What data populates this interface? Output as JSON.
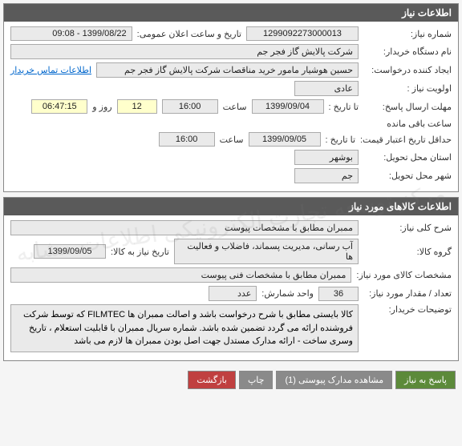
{
  "panel1": {
    "title": "اطلاعات نیاز",
    "need_number_label": "شماره نیاز:",
    "need_number": "1299092273000013",
    "public_datetime_label": "تاریخ و ساعت اعلان عمومی:",
    "public_datetime": "1399/08/22 - 09:08",
    "buyer_org_label": "نام دستگاه خریدار:",
    "buyer_org": "شرکت پالایش گاز فجر جم",
    "creator_label": "ایجاد کننده درخواست:",
    "creator": "حسین هوشیار مامور خرید مناقصات شرکت پالایش گاز فجر جم",
    "contact_link": "اطلاعات تماس خریدار",
    "priority_label": "اولویت نیاز :",
    "priority": "عادی",
    "deadline_label": "مهلت ارسال پاسخ:",
    "to_date_label": "تا تاریخ :",
    "deadline_date": "1399/09/04",
    "time_label": "ساعت",
    "deadline_time": "16:00",
    "days_remaining": "12",
    "days_label": "روز و",
    "time_remaining": "06:47:15",
    "remaining_label": "ساعت باقی مانده",
    "price_validity_label": "حداقل تاریخ اعتبار قیمت:",
    "price_validity_date": "1399/09/05",
    "price_validity_time": "16:00",
    "delivery_province_label": "استان محل تحویل:",
    "delivery_province": "بوشهر",
    "delivery_city_label": "شهر محل تحویل:",
    "delivery_city": "جم"
  },
  "panel2": {
    "title": "اطلاعات کالاهای مورد نیاز",
    "general_desc_label": "شرح کلی نیاز:",
    "general_desc": "ممبران مطابق با مشخصات پیوست",
    "group_label": "گروه کالا:",
    "group": "آب رسانی، مدیریت پسماند، فاضلاب و فعالیت ها",
    "need_date_label": "تاریخ نیاز به کالا:",
    "need_date": "1399/09/05",
    "specs_label": "مشخصات کالای مورد نیاز:",
    "specs": "ممبران مطابق با مشخصات فنی پیوست",
    "qty_label": "تعداد / مقدار مورد نیاز:",
    "qty": "36",
    "unit_label": "واحد شمارش:",
    "unit": "عدد",
    "buyer_notes_label": "توضیحات خریدار:",
    "buyer_notes": "کالا بایستی مطابق با شرح درخواست باشد و اصالت ممبران ها FILMTEC که توسط شرکت فروشنده ارائه می گردد  تضمین شده باشد. شماره سریال ممبران با قابلیت استعلام ، تاریخ وسری ساخت - ارائه مدارک مستدل جهت اصل بودن ممبران ها لازم می باشد"
  },
  "buttons": {
    "respond": "پاسخ به نیاز",
    "attachments": "مشاهده مدارک پیوستی (1)",
    "print": "چاپ",
    "back": "بازگشت"
  },
  "watermark": "مرکز توسعه تجارت الکترونیکی  اطلاعات مشابه"
}
